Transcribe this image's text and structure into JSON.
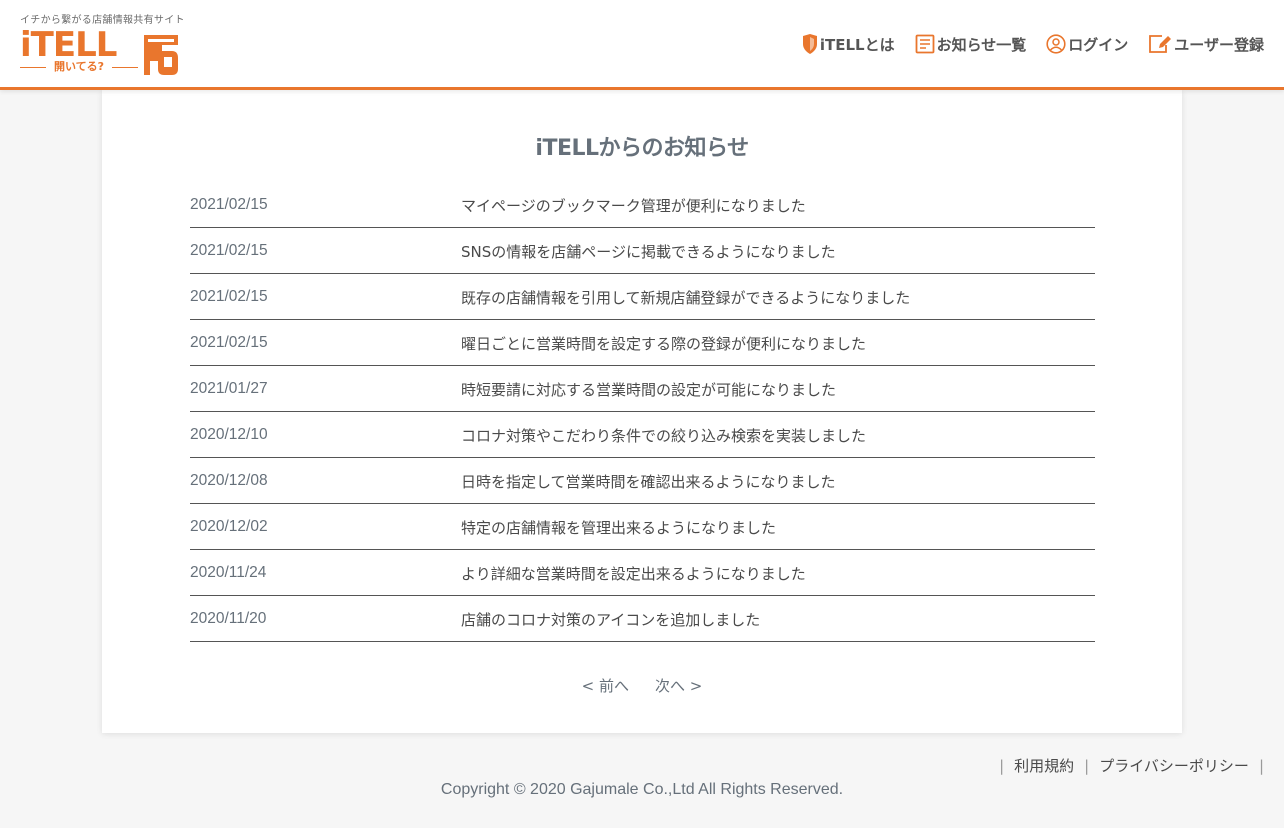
{
  "header": {
    "tagline": "イチから繋がる店舗情報共有サイト",
    "logo_text": "iTELL",
    "logo_sub": "開いてる?",
    "nav": [
      {
        "label": "iTELLとは",
        "icon": "shield-icon"
      },
      {
        "label": "お知らせ一覧",
        "icon": "document-icon"
      },
      {
        "label": "ログイン",
        "icon": "user-icon"
      },
      {
        "label": "ユーザー登録",
        "icon": "edit-icon"
      }
    ]
  },
  "main": {
    "title": "iTELLからのお知らせ",
    "news": [
      {
        "date": "2021/02/15",
        "title": "マイページのブックマーク管理が便利になりました"
      },
      {
        "date": "2021/02/15",
        "title": "SNSの情報を店舗ページに掲載できるようになりました"
      },
      {
        "date": "2021/02/15",
        "title": "既存の店舗情報を引用して新規店舗登録ができるようになりました"
      },
      {
        "date": "2021/02/15",
        "title": "曜日ごとに営業時間を設定する際の登録が便利になりました"
      },
      {
        "date": "2021/01/27",
        "title": "時短要請に対応する営業時間の設定が可能になりました"
      },
      {
        "date": "2020/12/10",
        "title": "コロナ対策やこだわり条件での絞り込み検索を実装しました"
      },
      {
        "date": "2020/12/08",
        "title": "日時を指定して営業時間を確認出来るようになりました"
      },
      {
        "date": "2020/12/02",
        "title": "特定の店舗情報を管理出来るようになりました"
      },
      {
        "date": "2020/11/24",
        "title": "より詳細な営業時間を設定出来るようになりました"
      },
      {
        "date": "2020/11/20",
        "title": "店舗のコロナ対策のアイコンを追加しました"
      }
    ],
    "pager": {
      "prev": "< 前へ",
      "next": "次へ >"
    }
  },
  "footer": {
    "separator": "|",
    "links": [
      "利用規約",
      "プライバシーポリシー"
    ],
    "copyright": "Copyright © 2020 Gajumale Co.,Ltd All Rights Reserved."
  },
  "colors": {
    "accent": "#e9762d",
    "text": "#4a4a4a",
    "muted": "#66707a"
  }
}
